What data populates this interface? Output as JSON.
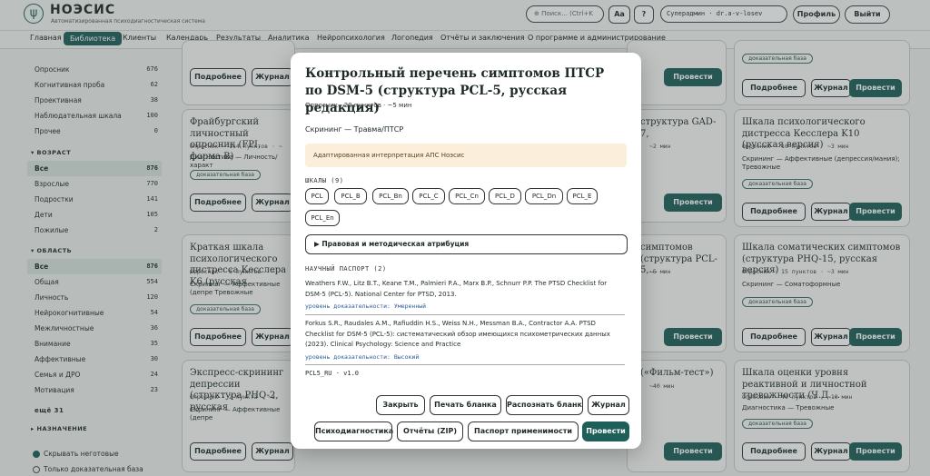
{
  "header": {
    "logo_glyph": "ψ",
    "brand": "НОЭСИС",
    "subtitle": "Автоматизированная психодиагностическая система",
    "search_placeholder": "⊕ Поиск... (Ctrl+K",
    "font_btn": "Aa",
    "help_btn": "?",
    "user": "Суперадмин · dr.a-v-losev",
    "profile_btn": "Профиль",
    "logout_btn": "Выйти"
  },
  "nav": [
    "Главная",
    "Библиотека",
    "Клиенты",
    "Календарь",
    "Результаты",
    "Аналитика",
    "Нейропсихология",
    "Логопедия",
    "Отчёты и заключения",
    "О программе и администрирование"
  ],
  "sidebar": {
    "type_rows": [
      {
        "label": "Опросник",
        "count": "676"
      },
      {
        "label": "Когнитивная проба",
        "count": "62"
      },
      {
        "label": "Проективная",
        "count": "38"
      },
      {
        "label": "Наблюдательная шкала",
        "count": "100"
      },
      {
        "label": "Прочее",
        "count": "0"
      }
    ],
    "age_head": "▾ ВОЗРАСТ",
    "age_rows": [
      {
        "label": "Все",
        "count": "876"
      },
      {
        "label": "Взрослые",
        "count": "770"
      },
      {
        "label": "Подростки",
        "count": "141"
      },
      {
        "label": "Дети",
        "count": "105"
      },
      {
        "label": "Пожилые",
        "count": "2"
      }
    ],
    "area_head": "▾ ОБЛАСТЬ",
    "area_rows": [
      {
        "label": "Все",
        "count": "876"
      },
      {
        "label": "Общая",
        "count": "554"
      },
      {
        "label": "Личность",
        "count": "120"
      },
      {
        "label": "Нейрокогнитивные",
        "count": "54"
      },
      {
        "label": "Межличностные",
        "count": "36"
      },
      {
        "label": "Внимание",
        "count": "35"
      },
      {
        "label": "Аффективные",
        "count": "30"
      },
      {
        "label": "Семья и ДРО",
        "count": "24"
      },
      {
        "label": "Мотивация",
        "count": "23"
      }
    ],
    "more": "ещё 31",
    "purpose_head": "▸ НАЗНАЧЕНИЕ",
    "hide_unready": "Скрывать неготовые",
    "only_evidence": "Только доказательная база"
  },
  "cards": {
    "more": "Подробнее",
    "journal": "Журнал",
    "run": "Провести",
    "evidence": "доказательная база",
    "c1_title": "Фрайбургский личностный опросник (FPI, форма B)",
    "c1_meta": "Опросник · 114 пунктов · ~",
    "c1_diag": "Диагностика — Личность/характ",
    "c2_title": "Краткая шкала психологического дистресса Кесслера K6 (русская",
    "c2_meta": "Опросник · 6 пунктов · ~",
    "c2_diag": "Скрининг — Аффективные (депре Тревожные",
    "c3_title": "Экспресс-скрининг депрессии (структура PHQ-2, русская",
    "c3_meta": "Опросник · 2 пункта · ~1",
    "c3_diag": "Скрининг — Аффективные (депре",
    "m1_title": "структура GAD-7,",
    "m1_meta": "~2 мин",
    "m2_title": "симптомов (структура PCL-5,...",
    "m2_meta": "~5 мин",
    "m3_title": "(«Фильм-тест»)",
    "m3_meta": "~40 мин",
    "r1_title": "Шкала психологического дистресса Кесслера K10 (русская версия)",
    "r1_meta": "Опросник · 10 пунктов · ~3 мин",
    "r1_diag": "Скрининг — Аффективные (депрессия/мания); Тревожные",
    "r2_title": "Шкала соматических симптомов (структура PHQ-15, русская версия)",
    "r2_meta": "Опросник · 15 пунктов · ~3 мин",
    "r2_diag": "Скрининг — Соматоформные",
    "r3_title": "Шкала оценки уровня реактивной и личностной тревожности (Ч.Д....",
    "r3_meta": "Опросник · 40 пунктов · ~10 мин",
    "r3_diag": "Диагностика — Тревожные"
  },
  "modal": {
    "title": "Контрольный перечень симптомов ПТСР по DSM-5 (структура PCL-5, русская редакция)",
    "subtitle": "Опросник · 20 пунктов · ~5 мин",
    "category": "Скрининг — Травма/ПТСР",
    "alert": "Адаптированная интерпретация АПС Ноэсис",
    "scales_head": "ШКАЛЫ (9)",
    "scales": [
      "PCL",
      "PCL_B",
      "PCL_Bn",
      "PCL_C",
      "PCL_Cn",
      "PCL_D",
      "PCL_Dn",
      "PCL_E",
      "PCL_En"
    ],
    "attribution": "▶ Правовая и методическая атрибуция",
    "passport_head": "НАУЧНЫЙ ПАСПОРТ (2)",
    "ref1": "Weathers F.W., Litz B.T., Keane T.M., Palmieri P.A., Marx B.P., Schnurr P.P. The PTSD Checklist for DSM-5 (PCL-5). National Center for PTSD, 2013.",
    "ref1_level": "уровень доказательности: Умеренный",
    "ref2": "Forkus S.R., Raudales A.M., Rafiuddin H.S., Weiss N.H., Messman B.A., Contractor A.A. PTSD Checklist for DSM-5 (PCL-5): систематический обзор имеющихся психометрических данных (2023). Clinical Psychology: Science and Practice",
    "ref2_level": "уровень доказательности: Высокий",
    "version": "PCL5_RU · v1.0",
    "btn_close": "Закрыть",
    "btn_print": "Печать бланка",
    "btn_recognize": "Распознать бланк",
    "btn_journal": "Журнал",
    "btn_psycho": "Психодиагностика",
    "btn_reports": "Отчёты (ZIP)",
    "btn_passport": "Паспорт применимости",
    "btn_run": "Провести"
  }
}
